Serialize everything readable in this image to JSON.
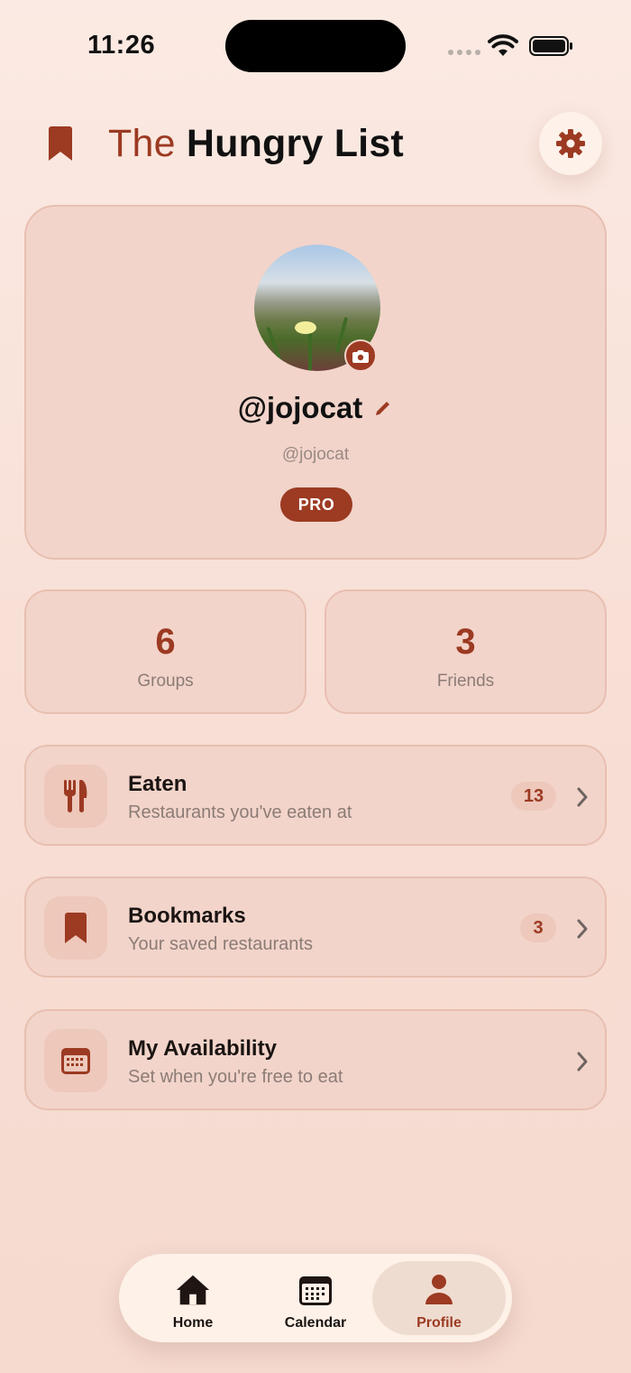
{
  "status_bar": {
    "time": "11:26"
  },
  "header": {
    "title_prefix": "The",
    "title_main": "Hungry List"
  },
  "profile": {
    "username": "@jojocat",
    "handle": "@jojocat",
    "badge": "PRO"
  },
  "stats": [
    {
      "value": "6",
      "label": "Groups"
    },
    {
      "value": "3",
      "label": "Friends"
    }
  ],
  "menu": [
    {
      "title": "Eaten",
      "subtitle": "Restaurants you've eaten at",
      "count": "13",
      "icon": "fork-knife-icon"
    },
    {
      "title": "Bookmarks",
      "subtitle": "Your saved restaurants",
      "count": "3",
      "icon": "bookmark-icon"
    },
    {
      "title": "My Availability",
      "subtitle": "Set when you're free to eat",
      "icon": "calendar-icon"
    }
  ],
  "tabs": [
    {
      "label": "Home",
      "icon": "home-icon"
    },
    {
      "label": "Calendar",
      "icon": "calendar-icon"
    },
    {
      "label": "Profile",
      "icon": "person-icon",
      "active": true
    }
  ],
  "colors": {
    "accent": "#9c3a22",
    "card": "#f2d4ca",
    "background": "#f7ddd3"
  }
}
